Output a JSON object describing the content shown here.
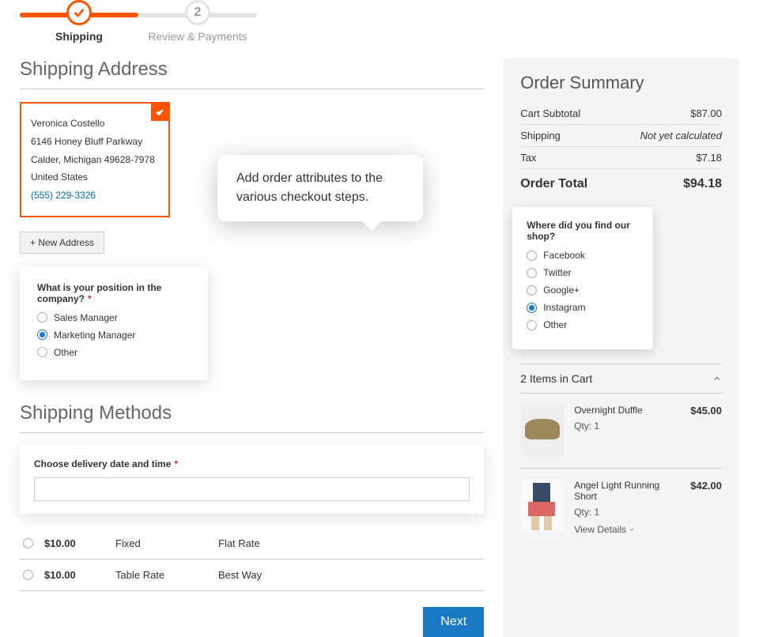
{
  "progress": {
    "step1_label": "Shipping",
    "step2_label": "Review & Payments",
    "step2_num": "2"
  },
  "sections": {
    "shipping_address": "Shipping Address",
    "shipping_methods": "Shipping Methods"
  },
  "address": {
    "name": "Veronica Costello",
    "street": "6146 Honey Bluff Parkway",
    "city_state": "Calder, Michigan 49628-7978",
    "country": "United States",
    "phone": "(555) 229-3326",
    "new_button": "+ New Address"
  },
  "position_q": {
    "label": "What is your position in the company?",
    "options": [
      "Sales Manager",
      "Marketing Manager",
      "Other"
    ],
    "selected": 1
  },
  "delivery": {
    "label": "Choose delivery date and time"
  },
  "shipping_methods": [
    {
      "price": "$10.00",
      "type": "Fixed",
      "name": "Flat Rate"
    },
    {
      "price": "$10.00",
      "type": "Table Rate",
      "name": "Best Way"
    }
  ],
  "next_btn": "Next",
  "tooltip": "Add order attributes to the various checkout steps.",
  "summary": {
    "title": "Order Summary",
    "rows": {
      "subtotal_label": "Cart Subtotal",
      "subtotal_value": "$87.00",
      "shipping_label": "Shipping",
      "shipping_value": "Not yet calculated",
      "tax_label": "Tax",
      "tax_value": "$7.18",
      "total_label": "Order Total",
      "total_value": "$94.18"
    }
  },
  "survey": {
    "label": "Where did you find our shop?",
    "options": [
      "Facebook",
      "Twitter",
      "Google+",
      "Instagram",
      "Other"
    ],
    "selected": 3
  },
  "cart": {
    "header": "2 Items in Cart",
    "items": [
      {
        "name": "Overnight Duffle",
        "qty": "Qty: 1",
        "price": "$45.00",
        "view": "",
        "thumb_style": "duffle"
      },
      {
        "name": "Angel Light Running Short",
        "qty": "Qty: 1",
        "price": "$42.00",
        "view": "View Details",
        "thumb_style": "short"
      }
    ]
  }
}
